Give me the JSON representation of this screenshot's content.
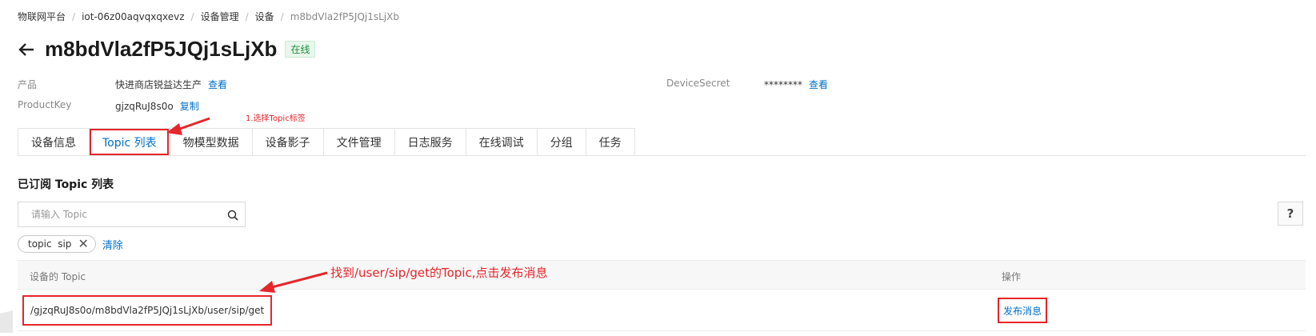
{
  "breadcrumb": [
    "物联网平台",
    "iot-06z00aqvqxqxevz",
    "设备管理",
    "设备",
    "m8bdVla2fP5JQj1sLjXb"
  ],
  "title": {
    "device_name": "m8bdVla2fP5JQj1sLjXb",
    "status": "在线",
    "status_color": "#1e8e3e",
    "back_icon": "arrow-left-icon"
  },
  "info": {
    "product_label": "产品",
    "product_value": "快进商店锐益达生产",
    "product_link": "查看",
    "productkey_label": "ProductKey",
    "productkey_value": "gjzqRuJ8s0o",
    "productkey_link": "复制",
    "secret_label": "DeviceSecret",
    "secret_value": "********",
    "secret_link": "查看"
  },
  "annotations": {
    "select_topic_tab": "1.选择Topic标签",
    "find_topic": "找到/user/sip/get的Topic,点击发布消息",
    "color": "#e5262b"
  },
  "tabs": [
    {
      "label": "设备信息"
    },
    {
      "label": "Topic 列表"
    },
    {
      "label": "物模型数据"
    },
    {
      "label": "设备影子"
    },
    {
      "label": "文件管理"
    },
    {
      "label": "日志服务"
    },
    {
      "label": "在线调试"
    },
    {
      "label": "分组"
    },
    {
      "label": "任务"
    }
  ],
  "active_tab": "Topic 列表",
  "section": {
    "title": "已订阅 Topic 列表"
  },
  "search": {
    "placeholder": "请输入 Topic",
    "value": "",
    "icon": "search-icon"
  },
  "help": {
    "label": "?"
  },
  "filter": {
    "tag": "topic  sip",
    "close": "✕",
    "clear": "清除"
  },
  "table": {
    "columns": [
      "设备的 Topic",
      "操作"
    ],
    "rows": [
      {
        "topic": "/gjzqRuJ8s0o/m8bdVla2fP5JQj1sLjXb/user/sip/get",
        "action": "发布消息"
      }
    ]
  },
  "colors": {
    "link": "#0070cc",
    "annotation": "#e5262b"
  }
}
